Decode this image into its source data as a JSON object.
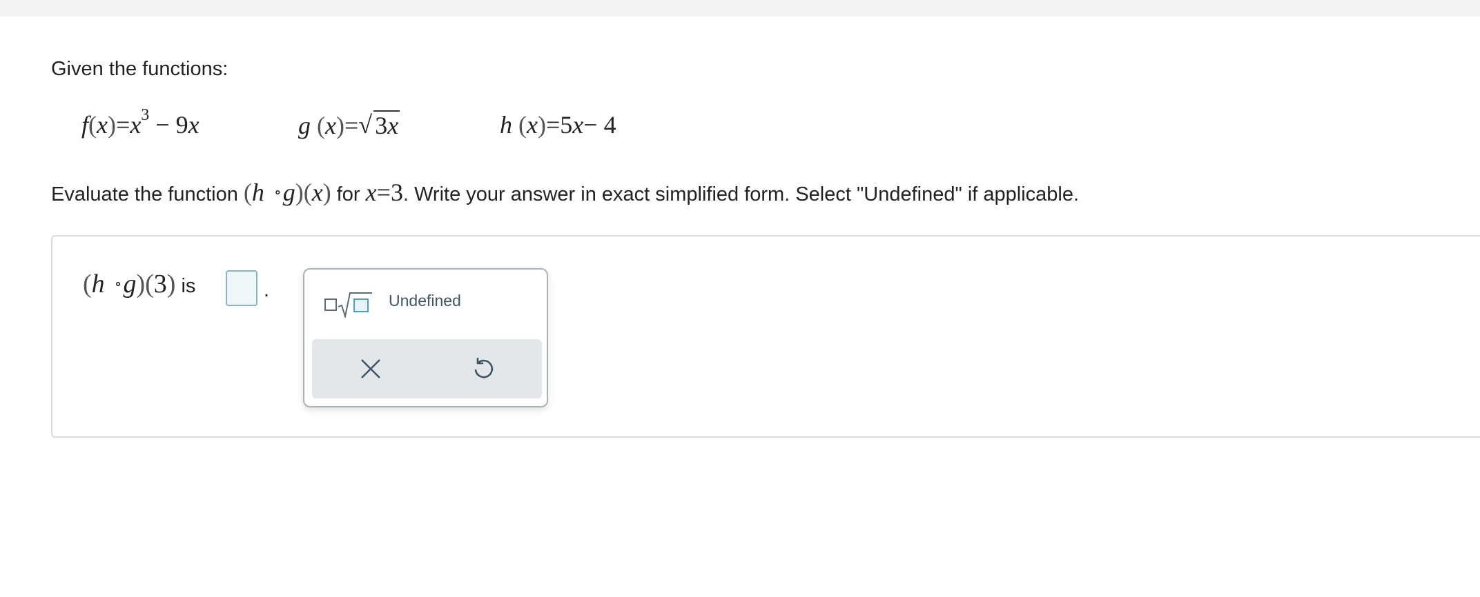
{
  "intro": {
    "text": "Given the functions:"
  },
  "functions": {
    "f": {
      "name": "f",
      "var": "x",
      "base": "x",
      "exponent": "3",
      "rest": "− 9",
      "rest_var": "x"
    },
    "g": {
      "name": "g",
      "var": "x",
      "radicand_num": "3",
      "radicand_var": "x"
    },
    "h": {
      "name": "h",
      "var": "x",
      "coef": "5",
      "rest": "− 4"
    }
  },
  "instruction": {
    "prefix": "Evaluate the function",
    "outer": "h",
    "compose": "∘",
    "inner": "g",
    "var": "x",
    "for_text": "for",
    "x_value_var": "x",
    "x_value_eq": "=3",
    "suffix": ". Write your answer in exact simplified form. Select \"Undefined\" if applicable."
  },
  "answer": {
    "outer": "h",
    "compose": "∘",
    "inner": "g",
    "arg": "3",
    "is_text": "is",
    "input_value": "",
    "period": "."
  },
  "palette": {
    "sqrt_icon": "square-root-icon",
    "undefined_label": "Undefined",
    "clear_icon": "close-icon",
    "undo_icon": "undo-icon"
  },
  "colors": {
    "top_bar": "#f0f2f3",
    "input_border": "#89b2c6",
    "input_bg": "#eef6f9",
    "palette_border": "#a7b3bb",
    "palette_actions_bg": "#e2e7ea",
    "icon_color": "#3d5566"
  }
}
